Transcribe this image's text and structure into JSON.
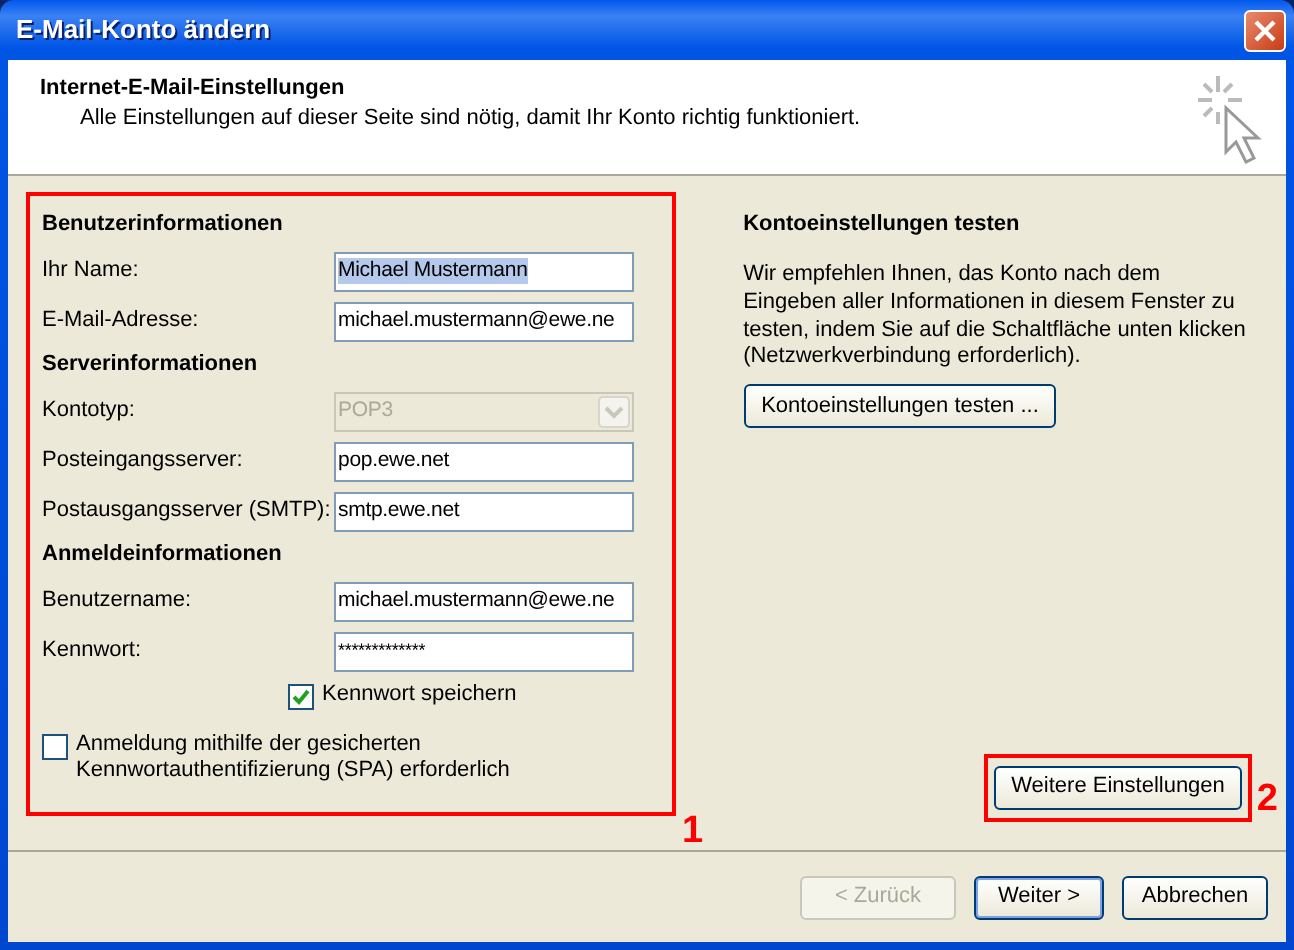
{
  "window": {
    "title": "E-Mail-Konto ändern"
  },
  "header": {
    "title": "Internet-E-Mail-Einstellungen",
    "subtitle": "Alle Einstellungen auf dieser Seite sind nötig, damit Ihr Konto richtig funktioniert."
  },
  "sections": [
    {
      "heading": "Benutzerinformationen",
      "fields": [
        {
          "kind": "text",
          "label": "Ihr Name:",
          "value": "Michael Mustermann",
          "highlighted": true,
          "disabled": false
        },
        {
          "kind": "text",
          "label": "E-Mail-Adresse:",
          "value": "michael.mustermann@ewe.ne",
          "highlighted": false,
          "disabled": false
        }
      ]
    },
    {
      "heading": "Serverinformationen",
      "fields": [
        {
          "kind": "select",
          "label": "Kontotyp:",
          "value": "POP3",
          "highlighted": false,
          "disabled": true
        },
        {
          "kind": "text",
          "label": "Posteingangsserver:",
          "value": "pop.ewe.net",
          "highlighted": false,
          "disabled": false
        },
        {
          "kind": "text",
          "label": "Postausgangsserver (SMTP):",
          "value": "smtp.ewe.net",
          "highlighted": false,
          "disabled": false
        }
      ]
    },
    {
      "heading": "Anmeldeinformationen",
      "fields": [
        {
          "kind": "text",
          "label": "Benutzername:",
          "value": "michael.mustermann@ewe.ne",
          "highlighted": false,
          "disabled": false
        },
        {
          "kind": "password",
          "label": "Kennwort:",
          "value": "*************",
          "highlighted": false,
          "disabled": false
        }
      ]
    }
  ],
  "save_password": {
    "label": "Kennwort speichern",
    "checked": true
  },
  "spa": {
    "label": "Anmeldung mithilfe der gesicherten Kennwortauthentifizierung (SPA) erforderlich",
    "checked": false
  },
  "test": {
    "heading": "Kontoeinstellungen testen",
    "text": "Wir empfehlen Ihnen, das Konto nach dem Eingeben aller Informationen in diesem Fenster zu testen, indem Sie auf die Schaltfläche unten klicken (Netzwerkverbindung erforderlich).",
    "button": "Kontoeinstellungen testen ..."
  },
  "more_button": "Weitere Einstellungen",
  "annotations": [
    {
      "label": "1"
    },
    {
      "label": "2"
    }
  ],
  "nav_buttons": [
    {
      "label": "< Zurück",
      "disabled": true,
      "default": false
    },
    {
      "label": "Weiter >",
      "disabled": false,
      "default": true
    },
    {
      "label": "Abbrechen",
      "disabled": false,
      "default": false
    }
  ]
}
